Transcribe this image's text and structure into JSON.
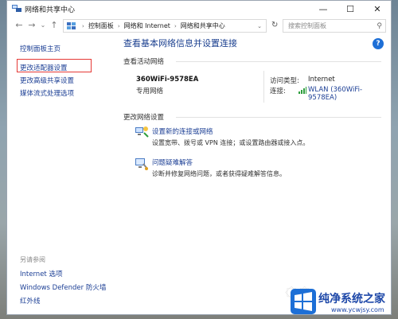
{
  "window": {
    "title": "网络和共享中心"
  },
  "titlebar": {
    "minimize": "—",
    "maximize": "☐",
    "close": "✕"
  },
  "nav": {
    "back": "←",
    "forward": "→",
    "dropdown": "⌄",
    "up": "↑"
  },
  "address": {
    "crumbs": [
      "控制面板",
      "网络和 Internet",
      "网络和共享中心"
    ],
    "separator": "›",
    "dropdown": "⌄"
  },
  "refresh": "↻",
  "search": {
    "placeholder": "搜索控制面板"
  },
  "sidebar": {
    "items": [
      "控制面板主页",
      "更改适配器设置",
      "更改高级共享设置",
      "媒体流式处理选项"
    ],
    "see_also_label": "另请参阅",
    "see_also": [
      "Internet 选项",
      "Windows Defender 防火墙",
      "红外线"
    ]
  },
  "help": "?",
  "main": {
    "title": "查看基本网络信息并设置连接",
    "active_networks_label": "查看活动网络",
    "network": {
      "name": "360WiFi-9578EA",
      "type": "专用网络",
      "access_type_label": "访问类型:",
      "access_type": "Internet",
      "connections_label": "连接:",
      "connection": "WLAN (360WiFi-9578EA)"
    },
    "change_settings_label": "更改网络设置",
    "tasks": [
      {
        "link": "设置新的连接或网络",
        "desc": "设置宽带、拨号或 VPN 连接；或设置路由器或接入点。"
      },
      {
        "link": "问题疑难解答",
        "desc": "诊断并修复网络问题，或者获得疑难解答信息。"
      }
    ]
  },
  "brand": {
    "name": "纯净系统之家",
    "url": "www.ycwjsy.com"
  },
  "colors": {
    "link": "#1c3f95",
    "highlight": "#e53935",
    "wifi": "#2e9e3e",
    "brand": "#1d47a8"
  }
}
